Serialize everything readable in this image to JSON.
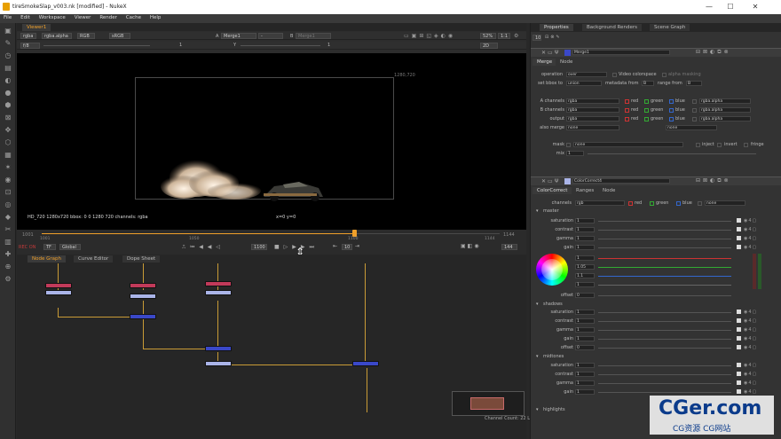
{
  "window": {
    "title": "tireSmokeSlap_v003.nk [modified] - NukeX",
    "min": "—",
    "max": "☐",
    "close": "✕"
  },
  "menu": [
    "File",
    "Edit",
    "Workspace",
    "Viewer",
    "Render",
    "Cache",
    "Help"
  ],
  "viewer": {
    "tab": "Viewer1",
    "channels": "rgba",
    "layer": "rgba.alpha",
    "display": "RGB",
    "colorspace": "sRGB",
    "input_a_label": "A",
    "input_a": "Merge1",
    "input_a_op": "-",
    "input_b_label": "B",
    "input_b": "Merge1",
    "zoom": "52%",
    "proxy": "1:1",
    "mode": "2D",
    "fstop": "f/8",
    "gain": "1",
    "y_label": "Y",
    "gamma": "1",
    "res_corner": "1280,720",
    "info_left": "HD_720 1280x720  bbox: 0 0 1280 720 channels: rgba",
    "info_coords": "x=0 y=0"
  },
  "timeline": {
    "start": "1001",
    "end": "1144",
    "mark_1050": "1050",
    "mark_1100": "1100",
    "fps_label": "TF",
    "scope": "Global",
    "current_frame": "1100",
    "step": "10",
    "out": "144",
    "end_field": "1144",
    "in_field": "1001",
    "playback_label": "REC ON"
  },
  "graph_tabs": [
    "Node Graph",
    "Curve Editor",
    "Dope Sheet"
  ],
  "status": "Channel Count: 22  Localization Mode: On  Memory: 3.3 GB (10.3%)  CPU:",
  "properties": {
    "tabs": [
      "Properties",
      "Background Renders",
      "Scene Graph"
    ],
    "max_panels": "10",
    "merge": {
      "name": "Merge1",
      "subtabs": [
        "Merge",
        "Node"
      ],
      "operation_label": "operation",
      "operation": "over",
      "video_colorspace": "Video colorspace",
      "alpha_masking": "alpha masking",
      "set_bbox_label": "set bbox to",
      "set_bbox": "union",
      "metadata_label": "metadata from",
      "metadata": "B",
      "range_label": "range from",
      "range": "B",
      "rows": [
        {
          "label": "A channels",
          "value": "rgba",
          "alpha": "rgba.alpha"
        },
        {
          "label": "B channels",
          "value": "rgba",
          "alpha": "rgba.alpha"
        },
        {
          "label": "output",
          "value": "rgba",
          "alpha": "rgba.alpha"
        },
        {
          "label": "also merge",
          "value": "none",
          "alpha": "none"
        }
      ],
      "red": "red",
      "green": "green",
      "blue": "blue",
      "mask_label": "mask",
      "mask": "none",
      "inject": "inject",
      "invert": "invert",
      "fringe": "fringe",
      "mix_label": "mix",
      "mix": "1"
    },
    "cc": {
      "name": "ColorCorrect4",
      "subtabs": [
        "ColorCorrect",
        "Ranges",
        "Node"
      ],
      "channels_label": "channels",
      "channels": "rgb",
      "red": "red",
      "green": "green",
      "blue": "blue",
      "extra": "none",
      "master_label": "master",
      "master": [
        {
          "label": "saturation",
          "value": "1"
        },
        {
          "label": "contrast",
          "value": "1"
        },
        {
          "label": "gamma",
          "value": "1"
        },
        {
          "label": "gain",
          "value": "1"
        }
      ],
      "wheel_values": [
        "1",
        "1.05",
        "1.1",
        "1"
      ],
      "offset_label": "offset",
      "offset": "0",
      "shadows_label": "shadows",
      "shadows": [
        {
          "label": "saturation",
          "value": "1"
        },
        {
          "label": "contrast",
          "value": "1"
        },
        {
          "label": "gamma",
          "value": "1"
        },
        {
          "label": "gain",
          "value": "1"
        },
        {
          "label": "offset",
          "value": "0"
        }
      ],
      "midtones_label": "midtones",
      "midtones": [
        {
          "label": "saturation",
          "value": "1"
        },
        {
          "label": "contrast",
          "value": "1"
        },
        {
          "label": "gamma",
          "value": "1"
        },
        {
          "label": "gain",
          "value": "1"
        }
      ],
      "highlights_label": "highlights"
    }
  },
  "watermark": {
    "main": "CGer.com",
    "sub": "CG资源 CG网站"
  },
  "colors": {
    "accent": "#f0a02a",
    "merge_node": "#3a48c8",
    "read_node": "#c23a5a",
    "wire": "#c99b36"
  }
}
